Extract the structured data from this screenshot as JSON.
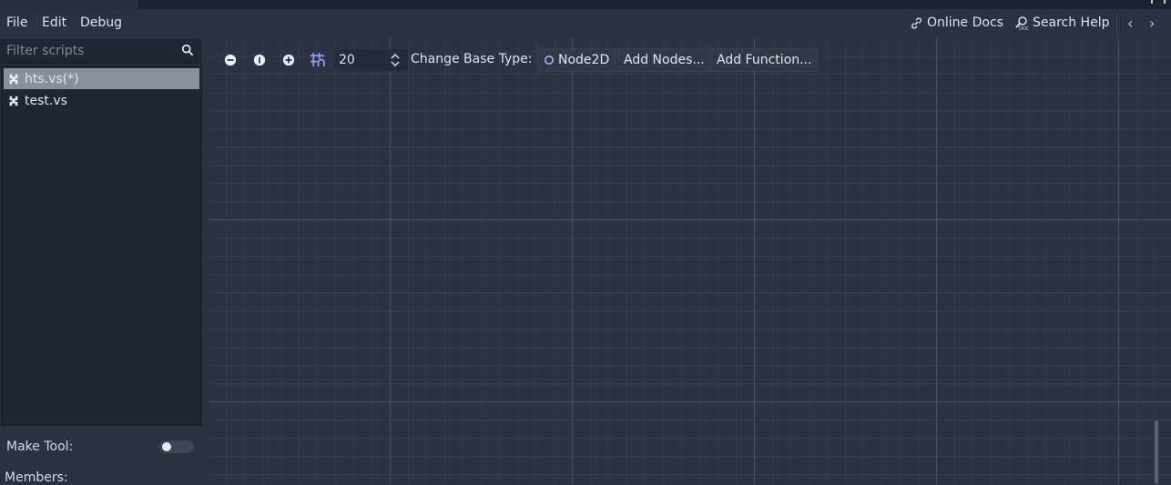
{
  "menu": {
    "file": "File",
    "edit": "Edit",
    "debug": "Debug"
  },
  "help": {
    "online_docs": "Online Docs",
    "search_help": "Search Help"
  },
  "nav": {
    "back": "‹",
    "forward": "›"
  },
  "sidebar": {
    "filter_placeholder": "Filter scripts",
    "scripts": [
      {
        "label": "hts.vs(*)",
        "selected": true
      },
      {
        "label": "test.vs",
        "selected": false
      }
    ],
    "make_tool_label": "Make Tool:",
    "make_tool_on": false,
    "members_label": "Members:"
  },
  "toolbar": {
    "snap_value": "20",
    "change_base_type_label": "Change Base Type:",
    "base_type": "Node2D",
    "add_nodes": "Add Nodes...",
    "add_function": "Add Function..."
  },
  "colors": {
    "background": "#2b3142",
    "graph_background": "#2c3244",
    "selected_item": "#8a8f9c",
    "accent_icon": "#8da5f3"
  }
}
